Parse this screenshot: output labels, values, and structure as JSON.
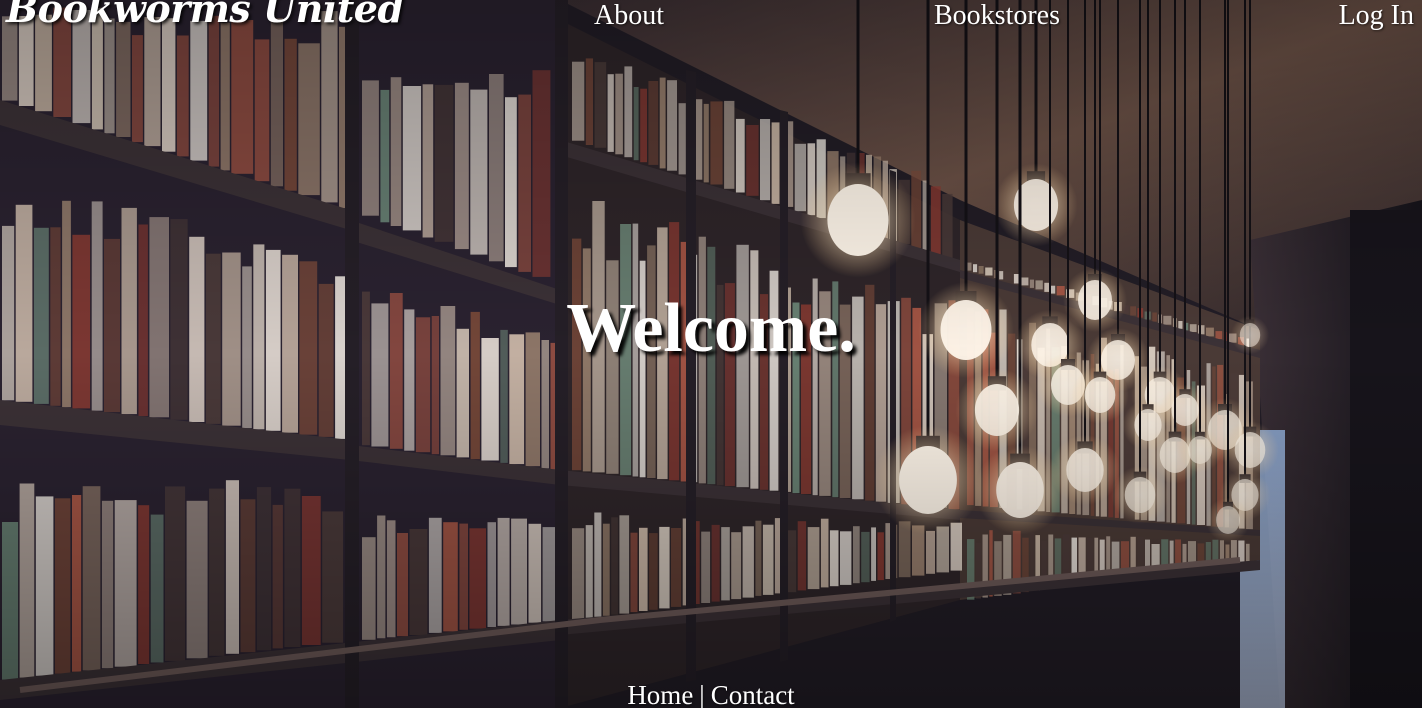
{
  "brand": {
    "name": "Bookworms United"
  },
  "nav": {
    "about": "About",
    "bookstores": "Bookstores",
    "login": "Log In"
  },
  "hero": {
    "title": "Welcome."
  },
  "footer": {
    "home": "Home",
    "separator": "|",
    "contact": "Contact"
  },
  "colors": {
    "text": "#ffffff",
    "shelf_dark": "#1f1b24",
    "ceiling": "#5a4438",
    "bulb_glow": "#fff4e0"
  }
}
